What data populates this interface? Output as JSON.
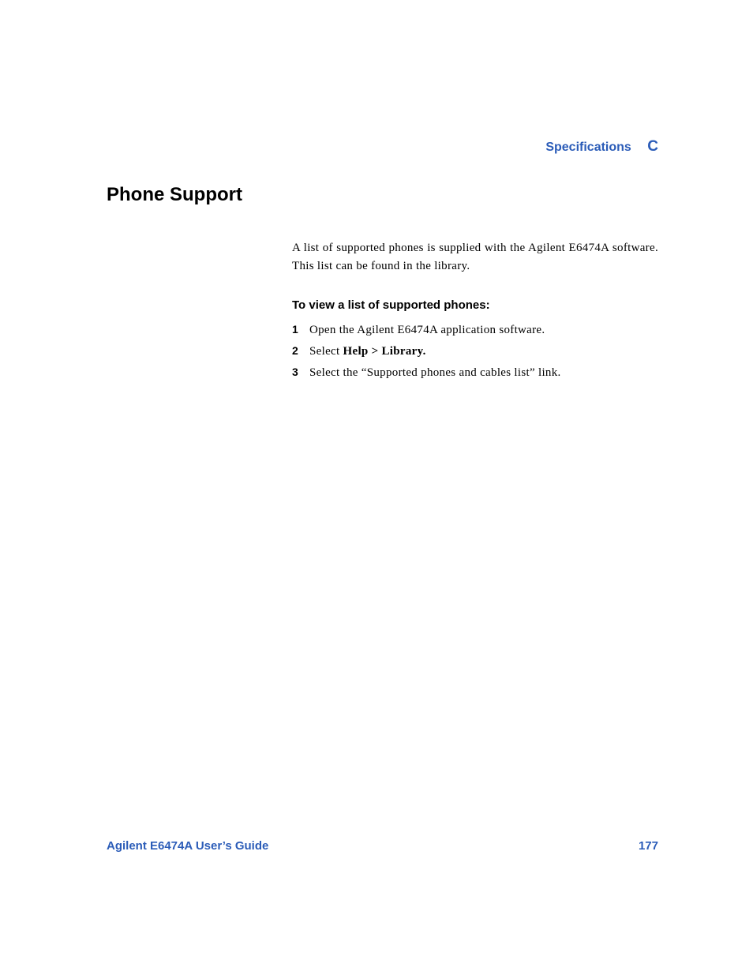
{
  "header": {
    "chapterName": "Specifications",
    "chapterLetter": "C"
  },
  "content": {
    "sectionHeading": "Phone Support",
    "introText": "A list of supported phones is supplied with the Agilent E6474A software. This list can be found in the library.",
    "subHeading": "To view a list of supported phones:",
    "steps": [
      {
        "prefix": "Open the Agilent E6474A application software."
      },
      {
        "prefix": "Select ",
        "bold": "Help > Library."
      },
      {
        "prefix": "Select the “Supported phones and cables list” link."
      }
    ]
  },
  "footer": {
    "guideTitle": "Agilent E6474A User’s Guide",
    "pageNumber": "177"
  }
}
